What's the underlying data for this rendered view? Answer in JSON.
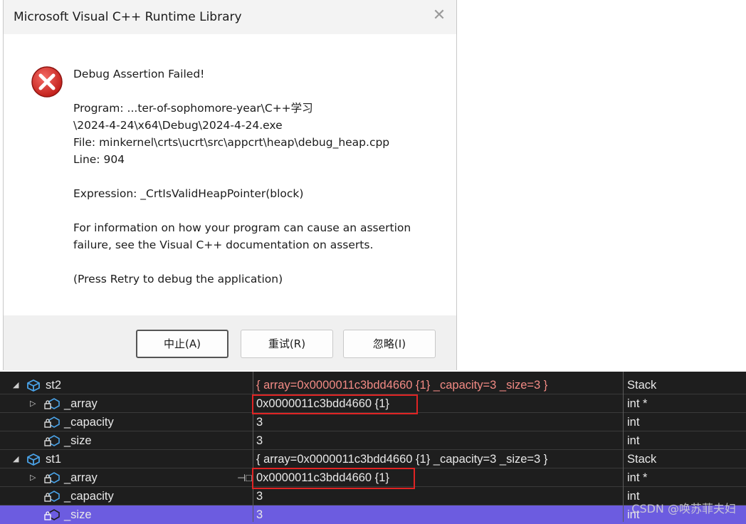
{
  "dialog": {
    "title": "Microsoft Visual C++ Runtime Library",
    "close_glyph": "✕",
    "lines": [
      "Debug Assertion Failed!",
      "",
      "Program: ...ter-of-sophomore-year\\C++学习",
      "\\2024-4-24\\x64\\Debug\\2024-4-24.exe",
      "File: minkernel\\crts\\ucrt\\src\\appcrt\\heap\\debug_heap.cpp",
      "Line: 904",
      "",
      "Expression: _CrtIsValidHeapPointer(block)",
      "",
      "For information on how your program can cause an assertion",
      "failure, see the Visual C++ documentation on asserts.",
      "",
      "(Press Retry to debug the application)"
    ],
    "buttons": {
      "abort": "中止(A)",
      "retry": "重试(R)",
      "ignore": "忽略(I)"
    }
  },
  "watch": {
    "rows": [
      {
        "name": "st2",
        "value": "{ array=0x0000011c3bdd4660 {1} _capacity=3 _size=3 }",
        "type": "Stack"
      },
      {
        "name": "_array",
        "value": "0x0000011c3bdd4660 {1}",
        "type": "int *"
      },
      {
        "name": "_capacity",
        "value": "3",
        "type": "int"
      },
      {
        "name": "_size",
        "value": "3",
        "type": "int"
      },
      {
        "name": "st1",
        "value": "{ array=0x0000011c3bdd4660 {1} _capacity=3 _size=3 }",
        "type": "Stack"
      },
      {
        "name": "_array",
        "value": "0x0000011c3bdd4660 {1}",
        "type": "int *"
      },
      {
        "name": "_capacity",
        "value": "3",
        "type": "int"
      },
      {
        "name": "_size",
        "value": "3",
        "type": "int"
      }
    ],
    "expand_open": "◢",
    "expand_closed": "▷",
    "pin_glyph": "⊣□"
  },
  "watermark": "CSDN @唤苏菲夫妇",
  "colors": {
    "changed_value": "#f28a84",
    "selected_row": "#6c5ce0",
    "highlight_box": "#e02424",
    "error_icon": "#d9302c"
  }
}
